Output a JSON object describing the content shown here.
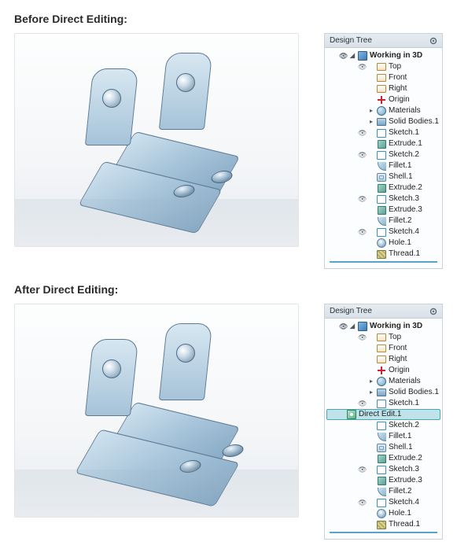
{
  "sections": {
    "before_title": "Before Direct Editing:",
    "after_title": "After Direct Editing:"
  },
  "panel": {
    "title": "Design Tree"
  },
  "tree_before": {
    "root": "Working in 3D",
    "items": [
      {
        "icon": "plane",
        "label": "Top",
        "eye": true
      },
      {
        "icon": "plane",
        "label": "Front",
        "eye": false
      },
      {
        "icon": "plane",
        "label": "Right",
        "eye": false
      },
      {
        "icon": "origin",
        "label": "Origin",
        "eye": false
      },
      {
        "icon": "mat",
        "label": "Materials",
        "eye": false,
        "expand": true
      },
      {
        "icon": "body",
        "label": "Solid Bodies.1",
        "eye": false,
        "expand": true
      },
      {
        "icon": "sketch",
        "label": "Sketch.1",
        "eye": true
      },
      {
        "icon": "extrude",
        "label": "Extrude.1",
        "eye": false
      },
      {
        "icon": "sketch",
        "label": "Sketch.2",
        "eye": true
      },
      {
        "icon": "fillet",
        "label": "Fillet.1",
        "eye": false
      },
      {
        "icon": "shell",
        "label": "Shell.1",
        "eye": false
      },
      {
        "icon": "extrude",
        "label": "Extrude.2",
        "eye": false
      },
      {
        "icon": "sketch",
        "label": "Sketch.3",
        "eye": true
      },
      {
        "icon": "extrude",
        "label": "Extrude.3",
        "eye": false
      },
      {
        "icon": "fillet",
        "label": "Fillet.2",
        "eye": false
      },
      {
        "icon": "sketch",
        "label": "Sketch.4",
        "eye": true
      },
      {
        "icon": "hole",
        "label": "Hole.1",
        "eye": false
      },
      {
        "icon": "thread",
        "label": "Thread.1",
        "eye": false
      }
    ]
  },
  "tree_after": {
    "root": "Working in 3D",
    "items": [
      {
        "icon": "plane",
        "label": "Top",
        "eye": true
      },
      {
        "icon": "plane",
        "label": "Front",
        "eye": false
      },
      {
        "icon": "plane",
        "label": "Right",
        "eye": false
      },
      {
        "icon": "origin",
        "label": "Origin",
        "eye": false
      },
      {
        "icon": "mat",
        "label": "Materials",
        "eye": false,
        "expand": true
      },
      {
        "icon": "body",
        "label": "Solid Bodies.1",
        "eye": false,
        "expand": true
      },
      {
        "icon": "sketch",
        "label": "Sketch.1",
        "eye": true
      },
      {
        "icon": "direct",
        "label": "Direct Edit.1",
        "eye": false,
        "selected": true
      },
      {
        "icon": "sketch",
        "label": "Sketch.2",
        "eye": false
      },
      {
        "icon": "fillet",
        "label": "Fillet.1",
        "eye": false
      },
      {
        "icon": "shell",
        "label": "Shell.1",
        "eye": false
      },
      {
        "icon": "extrude",
        "label": "Extrude.2",
        "eye": false
      },
      {
        "icon": "sketch",
        "label": "Sketch.3",
        "eye": true
      },
      {
        "icon": "extrude",
        "label": "Extrude.3",
        "eye": false
      },
      {
        "icon": "fillet",
        "label": "Fillet.2",
        "eye": false
      },
      {
        "icon": "sketch",
        "label": "Sketch.4",
        "eye": true
      },
      {
        "icon": "hole",
        "label": "Hole.1",
        "eye": false
      },
      {
        "icon": "thread",
        "label": "Thread.1",
        "eye": false
      }
    ]
  }
}
